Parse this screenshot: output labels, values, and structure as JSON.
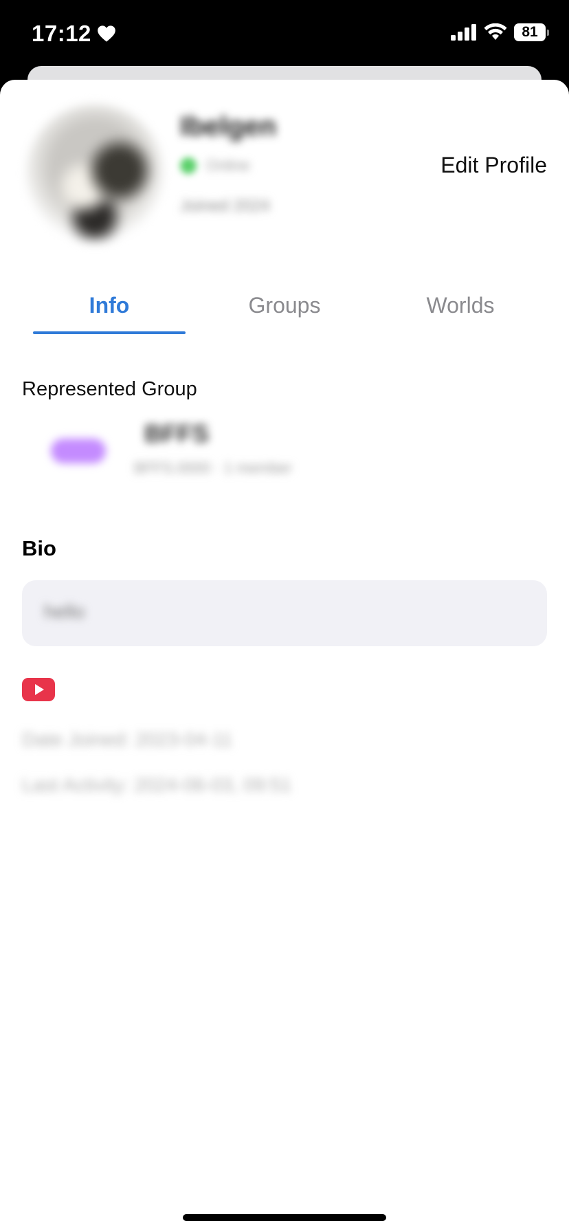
{
  "status_bar": {
    "time": "17:12",
    "battery": "81"
  },
  "profile": {
    "name": "Ibelgen",
    "status_text": "Online",
    "meta_text": "Joined 2024",
    "edit_label": "Edit Profile"
  },
  "tabs": [
    {
      "label": "Info",
      "active": true
    },
    {
      "label": "Groups",
      "active": false
    },
    {
      "label": "Worlds",
      "active": false
    }
  ],
  "represented_group": {
    "title": "Represented Group",
    "name": "BFFS",
    "subtitle": "BFFS.0000 · 1 member"
  },
  "bio": {
    "title": "Bio",
    "text": "hello"
  },
  "links": {
    "youtube_icon": "youtube-icon"
  },
  "dates": {
    "line1": "Date Joined: 2023-04-11",
    "line2": "Last Activity: 2024-06-03, 09:51"
  },
  "colors": {
    "accent": "#2f7ad8",
    "youtube": "#e8344a",
    "bio_bg": "#f1f1f6"
  }
}
